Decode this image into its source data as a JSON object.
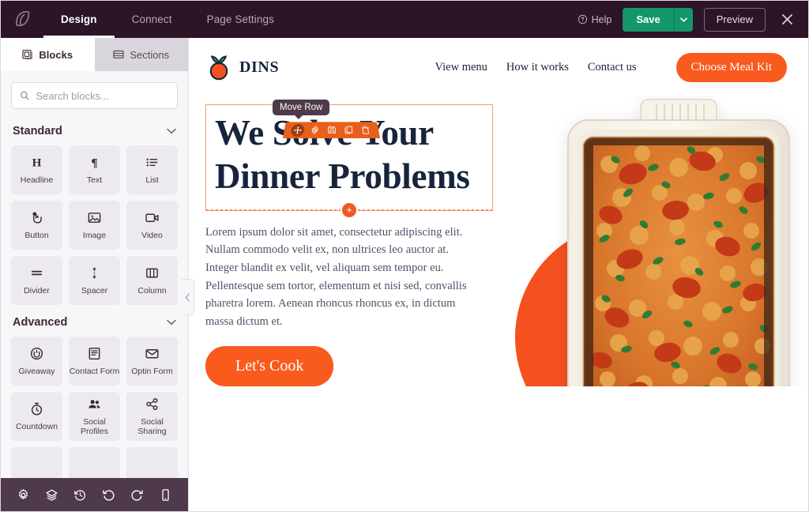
{
  "topbar": {
    "logo_icon": "leaf-logo-icon",
    "tabs": [
      {
        "label": "Design",
        "active": true
      },
      {
        "label": "Connect",
        "active": false
      },
      {
        "label": "Page Settings",
        "active": false
      }
    ],
    "help_label": "Help",
    "help_icon": "question-circle-icon",
    "save_label": "Save",
    "save_caret_icon": "chevron-down-icon",
    "preview_label": "Preview",
    "close_icon": "close-icon",
    "colors": {
      "bar_bg": "#2b1526",
      "save_green": "#12966a"
    }
  },
  "sidebar": {
    "tabs": [
      {
        "label": "Blocks",
        "icon": "blocks-icon",
        "active": true
      },
      {
        "label": "Sections",
        "icon": "sections-icon",
        "active": false
      }
    ],
    "search": {
      "placeholder": "Search blocks...",
      "value": "",
      "icon": "search-icon"
    },
    "groups": [
      {
        "title": "Standard",
        "chevron_icon": "chevron-down-icon",
        "blocks": [
          {
            "label": "Headline",
            "icon": "headline-icon"
          },
          {
            "label": "Text",
            "icon": "paragraph-icon"
          },
          {
            "label": "List",
            "icon": "list-icon"
          },
          {
            "label": "Button",
            "icon": "button-pointer-icon"
          },
          {
            "label": "Image",
            "icon": "image-icon"
          },
          {
            "label": "Video",
            "icon": "video-icon"
          },
          {
            "label": "Divider",
            "icon": "divider-icon"
          },
          {
            "label": "Spacer",
            "icon": "spacer-icon"
          },
          {
            "label": "Column",
            "icon": "column-icon"
          }
        ]
      },
      {
        "title": "Advanced",
        "chevron_icon": "chevron-down-icon",
        "blocks": [
          {
            "label": "Giveaway",
            "icon": "giveaway-icon"
          },
          {
            "label": "Contact Form",
            "icon": "contact-form-icon"
          },
          {
            "label": "Optin Form",
            "icon": "envelope-icon"
          },
          {
            "label": "Countdown",
            "icon": "stopwatch-icon"
          },
          {
            "label": "Social Profiles",
            "icon": "people-icon"
          },
          {
            "label": "Social Sharing",
            "icon": "share-icon"
          }
        ]
      }
    ],
    "collapse_icon": "chevron-left-icon",
    "bottom_tools": [
      {
        "icon": "gear-icon",
        "name": "settings"
      },
      {
        "icon": "layers-icon",
        "name": "layers"
      },
      {
        "icon": "history-icon",
        "name": "revisions"
      },
      {
        "icon": "undo-icon",
        "name": "undo"
      },
      {
        "icon": "redo-icon",
        "name": "redo"
      },
      {
        "icon": "mobile-icon",
        "name": "device-preview"
      }
    ]
  },
  "row_toolbar": {
    "tooltip": "Move Row",
    "tools": [
      {
        "icon": "move-arrows-icon",
        "name": "move-row",
        "selected": true
      },
      {
        "icon": "gear-icon",
        "name": "row-settings",
        "selected": false
      },
      {
        "icon": "save-icon",
        "name": "save-row",
        "selected": false
      },
      {
        "icon": "duplicate-icon",
        "name": "duplicate-row",
        "selected": false
      },
      {
        "icon": "trash-icon",
        "name": "delete-row",
        "selected": false
      }
    ]
  },
  "canvas": {
    "site_header": {
      "brand_name": "DINS",
      "brand_icon": "tomato-logo-icon",
      "nav": [
        {
          "label": "View menu"
        },
        {
          "label": "How it works"
        },
        {
          "label": "Contact us"
        }
      ],
      "cta_label": "Choose Meal Kit"
    },
    "hero": {
      "headline": "We Solve Your Dinner Problems",
      "paragraph": "Lorem ipsum dolor sit amet, consectetur adipiscing elit. Nullam commodo velit ex, non ultrices leo auctor at. Integer blandit ex velit, vel aliquam sem tempor eu. Pellentesque sem tortor, elementum et nisi sed, convallis pharetra lorem. Aenean rhoncus rhoncus ex, in dictum massa dictum et.",
      "button_label": "Let's Cook",
      "add_block_icon": "plus-circle-icon",
      "image_alt": "baked pasta casserole with pepperoni and parsley in white dish",
      "accent_color": "#f95a1e",
      "headline_color": "#17243c"
    }
  }
}
